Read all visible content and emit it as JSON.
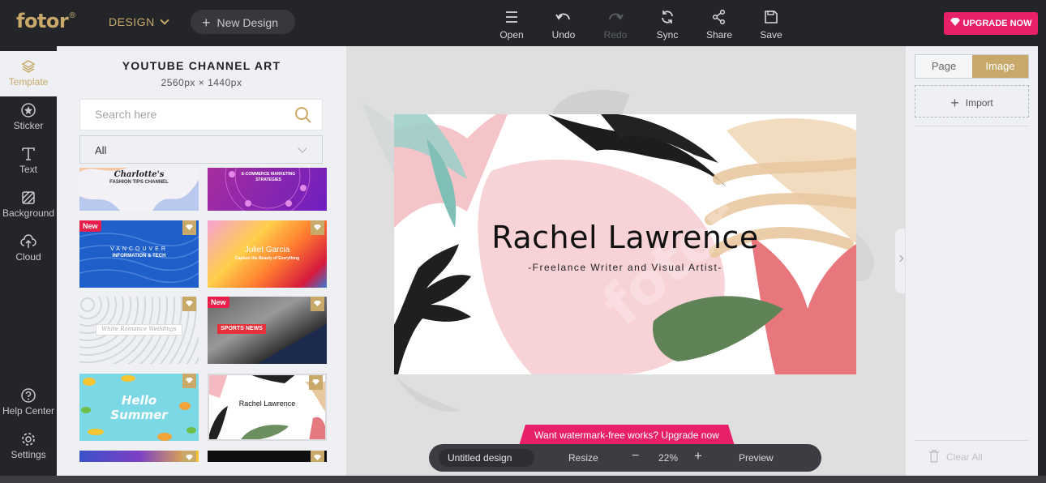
{
  "topbar": {
    "logo": "fotor",
    "logo_reg": "®",
    "design_menu": "DESIGN",
    "new_design": "New Design",
    "tools": {
      "open": "Open",
      "undo": "Undo",
      "redo": "Redo",
      "sync": "Sync",
      "share": "Share",
      "save": "Save"
    },
    "upgrade": "UPGRADE NOW"
  },
  "leftnav": {
    "template": "Template",
    "sticker": "Sticker",
    "text": "Text",
    "background": "Background",
    "cloud": "Cloud",
    "help": "Help Center",
    "settings": "Settings"
  },
  "panel": {
    "title": "YOUTUBE CHANNEL ART",
    "size": "2560px × 1440px",
    "search_placeholder": "Search here",
    "filter_value": "All",
    "badge_new": "New",
    "thumbs": {
      "t1_title": "Charlotte's",
      "t1_sub": "FASHION TIPS CHANNEL",
      "t2_title": "E-COMMERCE MARKETING STRATEGIES",
      "t3_title": "VANCOUVER",
      "t3_sub": "INFORMATION & TECH",
      "t4_title": "Juliet Garcia",
      "t4_sub": "Capture the Beauty of Everything",
      "t5_title": "White Romance Weddings",
      "t6_title": "SPORTS NEWS",
      "t7_title": "Hello",
      "t7_sub": "Summer",
      "t8_title": "Rachel Lawrence"
    }
  },
  "canvas": {
    "name": "Rachel Lawrence",
    "tagline": "-Freelance Writer and Visual Artist-",
    "watermark_banner": "Want watermark-free works? Upgrade now",
    "file_name": "Untitled design",
    "resize": "Resize",
    "zoom_minus": "−",
    "zoom": "22%",
    "zoom_plus": "+",
    "preview": "Preview"
  },
  "rpanel": {
    "tab_page": "Page",
    "tab_image": "Image",
    "import": "Import",
    "clear_all": "Clear All"
  },
  "colors": {
    "accent_gold": "#c8a96a",
    "upgrade_pink": "#e81f69",
    "topbar_bg": "#232529"
  }
}
